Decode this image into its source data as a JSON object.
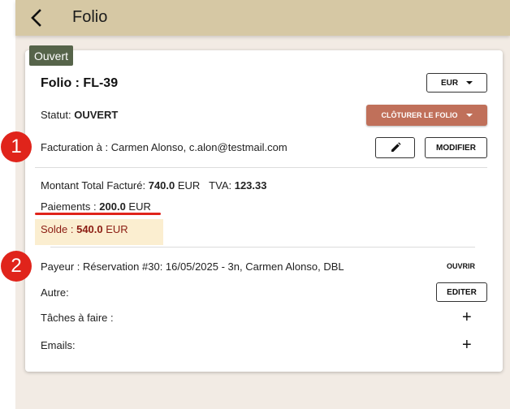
{
  "header": {
    "title": "Folio"
  },
  "status_chip": "Ouvert",
  "folio": {
    "title": "Folio : FL-39",
    "currency": "EUR",
    "status_label": "Statut: ",
    "status_value": "OUVERT",
    "close_button": "CLÔTURER LE FOLIO"
  },
  "billing": {
    "label": "Facturation à : ",
    "value": "Carmen Alonso, c.alon@testmail.com",
    "modify_button": "MODIFIER"
  },
  "totals": {
    "total_label": "Montant Total Facturé: ",
    "total_value": "740.0",
    "total_currency": " EUR",
    "vat_label": "TVA: ",
    "vat_value": "123.33",
    "payments_label": "Paiements : ",
    "payments_value": "200.0",
    "payments_currency": " EUR",
    "balance_label": "Solde : ",
    "balance_value": "540.0",
    "balance_currency": " EUR"
  },
  "payer": {
    "label": "Payeur : ",
    "value": "Réservation #30: 16/05/2025 - 3n, Carmen Alonso, DBL",
    "open_button": "OUVRIR"
  },
  "other": {
    "label": "Autre:",
    "edit_button": "EDITER"
  },
  "tasks": {
    "label": "Tâches à faire :"
  },
  "emails": {
    "label": "Emails:"
  },
  "annotations": {
    "badge_1": "1",
    "badge_2": "2"
  },
  "colors": {
    "topbar": "#d6c8a4",
    "background": "#f2ebe4",
    "status_chip": "#56644a",
    "close_button": "#c0705a",
    "badge": "#e0241b",
    "balance_text": "#8b1c12",
    "balance_highlight": "#fbeed0"
  },
  "icons": {
    "back": "chevron-left-icon",
    "edit": "pencil-icon",
    "add": "plus-icon",
    "dropdown": "caret-down-icon"
  }
}
